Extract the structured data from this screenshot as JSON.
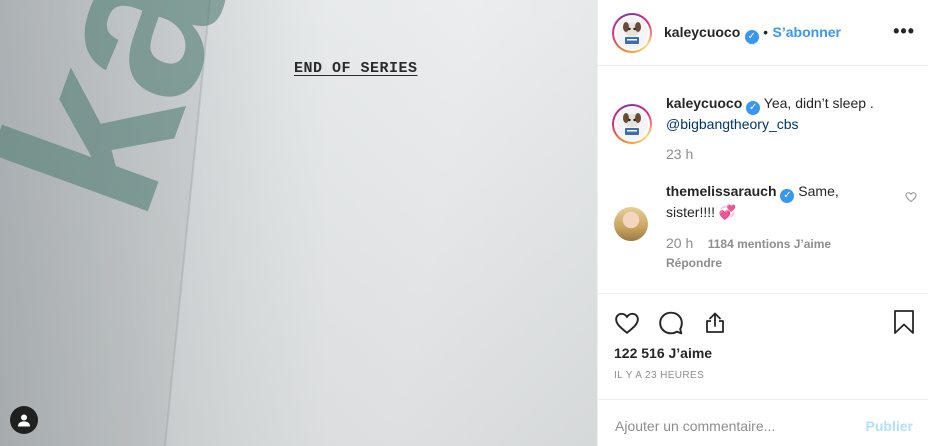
{
  "photo": {
    "script_title": "END OF SERIES",
    "watermark_text": "kaley C"
  },
  "header": {
    "username": "kaleycuoco",
    "separator": "•",
    "follow_label": "S’abonner",
    "more_label": "•••"
  },
  "caption": {
    "username": "kaleycuoco",
    "text": "Yea, didn’t sleep .",
    "mention": "@bigbangtheory_cbs",
    "time": "23 h"
  },
  "comment": {
    "username": "themelissarauch",
    "text_line1": "Same,",
    "text_line2": "sister!!!!",
    "emoji": "💞",
    "time": "20 h",
    "likes": "1184 mentions J’aime",
    "reply_label": "Répondre"
  },
  "actions": {
    "likes_count": "122 516 J’aime",
    "posted": "IL Y A 23 HEURES"
  },
  "add_comment": {
    "placeholder": "Ajouter un commentaire...",
    "publish_label": "Publier"
  },
  "colors": {
    "accent": "#3897f0",
    "watermark": "#56807a",
    "publish_disabled": "#b2dffc"
  }
}
